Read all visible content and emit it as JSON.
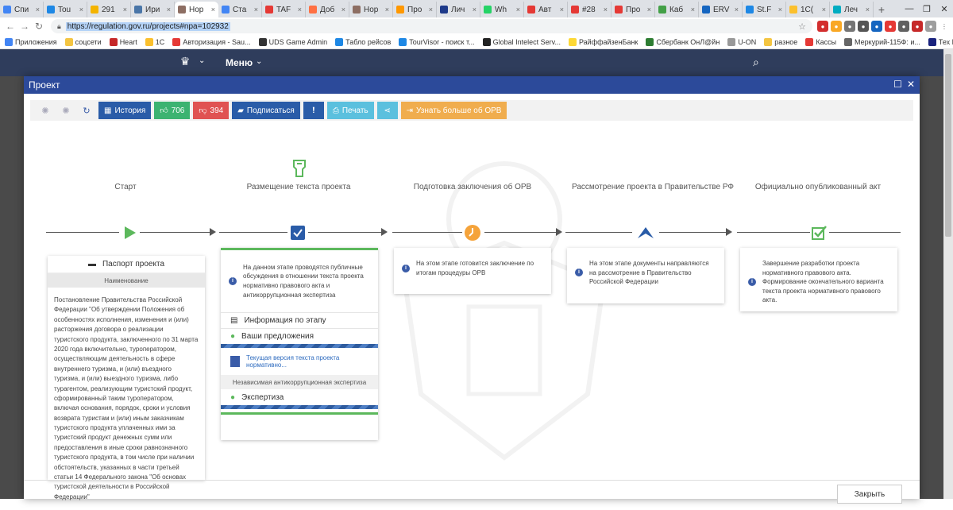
{
  "browser": {
    "tabs": [
      {
        "title": "Спи",
        "color": "#4285f4"
      },
      {
        "title": "Tou",
        "color": "#1e88e5"
      },
      {
        "title": "291",
        "color": "#f4b400"
      },
      {
        "title": "Ири",
        "color": "#4a76a8"
      },
      {
        "title": "Нор",
        "color": "#8d6e63",
        "active": true
      },
      {
        "title": "Ста",
        "color": "#4285f4"
      },
      {
        "title": "TAF",
        "color": "#e53935"
      },
      {
        "title": "Доб",
        "color": "#ff7043"
      },
      {
        "title": "Нор",
        "color": "#8d6e63"
      },
      {
        "title": "Про",
        "color": "#ff9800"
      },
      {
        "title": "Лич",
        "color": "#1e3a8a"
      },
      {
        "title": "Wh",
        "color": "#25d366"
      },
      {
        "title": "Авт",
        "color": "#e53935"
      },
      {
        "title": "#28",
        "color": "#e53935"
      },
      {
        "title": "Про",
        "color": "#e53935"
      },
      {
        "title": "Каб",
        "color": "#43a047"
      },
      {
        "title": "ERV",
        "color": "#1565c0"
      },
      {
        "title": "St.F",
        "color": "#1e88e5"
      },
      {
        "title": "1C(",
        "color": "#fbc02d"
      },
      {
        "title": "Леч",
        "color": "#00acc1"
      }
    ],
    "new_tab": "+",
    "url": "https://regulation.gov.ru/projects#npa=102932",
    "bookmarks": [
      {
        "label": "Приложения",
        "color": "#4285f4"
      },
      {
        "label": "соцсети",
        "color": "#f4c542"
      },
      {
        "label": "Heart",
        "color": "#c62828"
      },
      {
        "label": "1С",
        "color": "#fbc02d"
      },
      {
        "label": "Авторизация - Sau...",
        "color": "#e53935"
      },
      {
        "label": "UDS Game Admin",
        "color": "#333333"
      },
      {
        "label": "Табло рейсов",
        "color": "#1e88e5"
      },
      {
        "label": "TourVisor - поиск т...",
        "color": "#1e88e5"
      },
      {
        "label": "Global Intelect Serv...",
        "color": "#222222"
      },
      {
        "label": "РайффайзенБанк",
        "color": "#fdd835"
      },
      {
        "label": "Сбербанк ОнЛ@йн",
        "color": "#2e7d32"
      },
      {
        "label": "U-ON",
        "color": "#999999"
      },
      {
        "label": "разное",
        "color": "#f4c542"
      },
      {
        "label": "Кассы",
        "color": "#e53935"
      },
      {
        "label": "Меркурий-115Ф: и...",
        "color": "#666666"
      },
      {
        "label": "Тех Пом МФУ",
        "color": "#1a237e"
      }
    ]
  },
  "site": {
    "menu_label": "Меню"
  },
  "modal": {
    "title": "Проект",
    "toolbar": {
      "history": "История",
      "likes": "706",
      "dislikes": "394",
      "subscribe": "Подписаться",
      "print": "Печать",
      "learn_more": "Узнать больше об ОРВ"
    },
    "stages": [
      {
        "label": "Старт"
      },
      {
        "label": "Размещение текста проекта"
      },
      {
        "label": "Подготовка заключения об ОРВ"
      },
      {
        "label": "Рассмотрение проекта в Правительстве РФ"
      },
      {
        "label": "Официально опубликованный акт"
      }
    ],
    "passport": {
      "title": "Паспорт проекта",
      "subtitle": "Наименование",
      "text": "Постановление Правительства Российской Федерации \"Об утверждении Положения об особенностях исполнения, изменения и (или) расторжения договора о реализации туристского продукта, заключенного по 31 марта 2020 года включительно, туроператором, осуществляющим деятельность в сфере внутреннего туризма, и (или) въездного туризма, и (или) выездного туризма, либо турагентом, реализующим туристский продукт, сформированный таким туроператором, включая основания, порядок, сроки и условия возврата туристам и (или) иным заказчикам туристского продукта уплаченных ими за туристский продукт денежных сумм или предоставления в иные сроки равнозначного туристского продукта, в том числе при наличии обстоятельств, указанных в части третьей статьи 14 Федерального закона \"Об основах туристской деятельности в Российской Федерации\""
    },
    "placement": {
      "info": "На данном этапе проводятся публичные обсуждения в отношении текста проекта нормативно правового акта и антикоррупционная экспертиза",
      "stage_info": "Информация по этапу",
      "proposals": "Ваши предложения",
      "current_doc": "Текущая версия текста проекта нормативно...",
      "anticorruption": "Независимая антикоррупционная экспертиза",
      "expertise": "Экспертиза"
    },
    "orv": {
      "info": "На этом этапе готовится заключение по итогам процедуры ОРВ"
    },
    "government": {
      "info": "На этом этапе документы направляются на рассмотрение в Правительство Российской Федерации"
    },
    "published": {
      "info": "Завершение разработки проекта нормативного правового акта. Формирование окончательного варианта текста проекта нормативного правового акта."
    },
    "close": "Закрыть"
  },
  "colors": {
    "modal_header": "#2c4a9a",
    "site_header": "#2f3d5c",
    "history_btn": "#2a5ca8",
    "likes_btn": "#3cb371",
    "dislikes_btn": "#e05252",
    "subscribe_btn": "#2a5ca8",
    "alert_btn": "#2a5ca8",
    "print_btn": "#5bc0de",
    "share_btn": "#5bc0de",
    "learn_btn": "#f0ad4e",
    "accent_green": "#5cb85c",
    "orv_orange": "#f5a33a"
  }
}
